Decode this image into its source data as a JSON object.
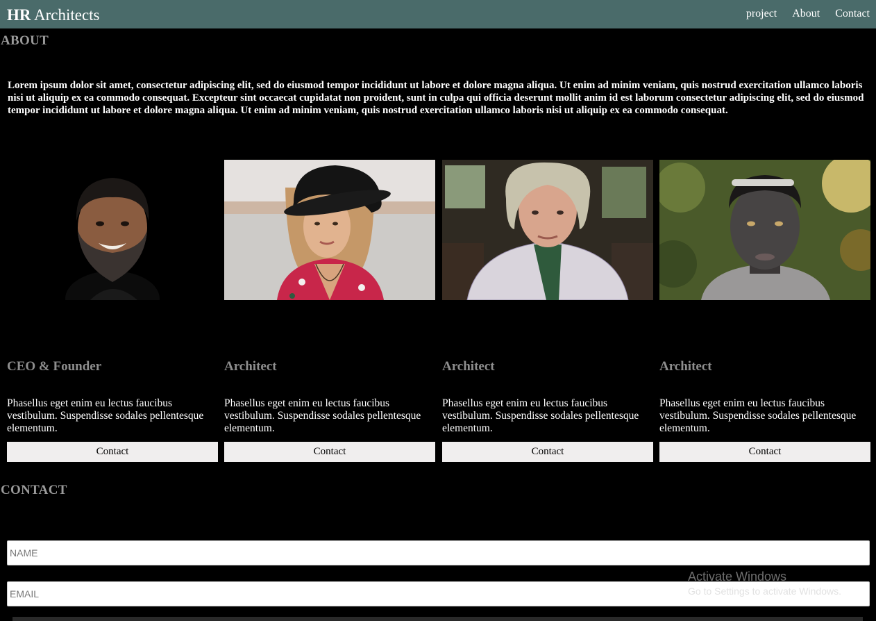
{
  "navbar": {
    "brand_bold": "HR",
    "brand_rest": "Architects",
    "links": [
      "project",
      "About",
      "Contact"
    ]
  },
  "about": {
    "title": "ABOUT",
    "text": "Lorem ipsum dolor sit amet, consectetur adipiscing elit, sed do eiusmod tempor incididunt ut labore et dolore magna aliqua. Ut enim ad minim veniam, quis nostrud exercitation ullamco laboris nisi ut aliquip ex ea commodo consequat. Excepteur sint occaecat cupidatat non proident, sunt in culpa qui officia deserunt mollit anim id est laborum consectetur adipiscing elit, sed do eiusmod tempor incididunt ut labore et dolore magna aliqua. Ut enim ad minim veniam, quis nostrud exercitation ullamco laboris nisi ut aliquip ex ea commodo consequat."
  },
  "team": [
    {
      "role": "CEO & Founder",
      "desc": "Phasellus eget enim eu lectus faucibus vestibulum. Suspendisse sodales pellentesque elementum.",
      "button": "Contact"
    },
    {
      "role": "Architect",
      "desc": "Phasellus eget enim eu lectus faucibus vestibulum. Suspendisse sodales pellentesque elementum.",
      "button": "Contact"
    },
    {
      "role": "Architect",
      "desc": "Phasellus eget enim eu lectus faucibus vestibulum. Suspendisse sodales pellentesque elementum.",
      "button": "Contact"
    },
    {
      "role": "Architect",
      "desc": "Phasellus eget enim eu lectus faucibus vestibulum. Suspendisse sodales pellentesque elementum.",
      "button": "Contact"
    }
  ],
  "contact": {
    "title": "CONTACT",
    "name_placeholder": "NAME",
    "email_placeholder": "EMAIL"
  },
  "watermark": {
    "line1": "Activate Windows",
    "line2": "Go to Settings to activate Windows."
  },
  "colors": {
    "navbar": "#4a6b6a",
    "background": "#000000",
    "heading_gray": "#9a9a9a",
    "button_bg": "#f0eeee"
  }
}
